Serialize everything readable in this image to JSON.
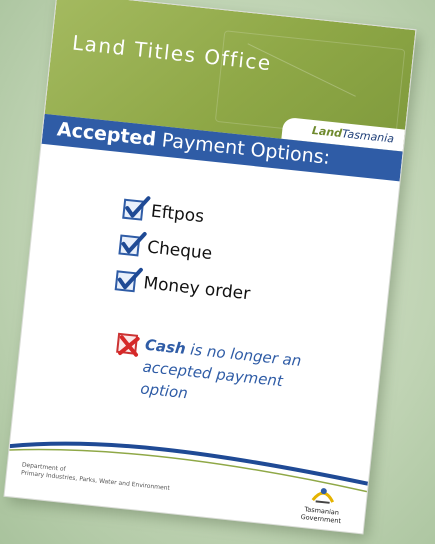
{
  "poster": {
    "header_title": "Land Titles Office",
    "brand_land": "Land",
    "brand_tasmania": "Tasmania",
    "band_bold": "Accepted",
    "band_rest": " Payment Options:",
    "options": [
      {
        "label": "Eftpos"
      },
      {
        "label": "Cheque"
      },
      {
        "label": "Money order"
      }
    ],
    "cash_bold": "Cash",
    "cash_rest": " is no longer an accepted payment option",
    "dept_line1": "Department of",
    "dept_line2": "Primary Industries, Parks, Water and Environment",
    "gov_line1": "Tasmanian",
    "gov_line2": "Government"
  },
  "colors": {
    "header_green": "#8fa847",
    "band_blue": "#2f5ca6",
    "check_blue": "#2f5ca6",
    "cross_red": "#cc3333",
    "background": "#c2d6b6"
  },
  "icons": [
    "checkbox-checked-icon",
    "checkbox-cross-icon",
    "tasmanian-government-logo-icon"
  ]
}
